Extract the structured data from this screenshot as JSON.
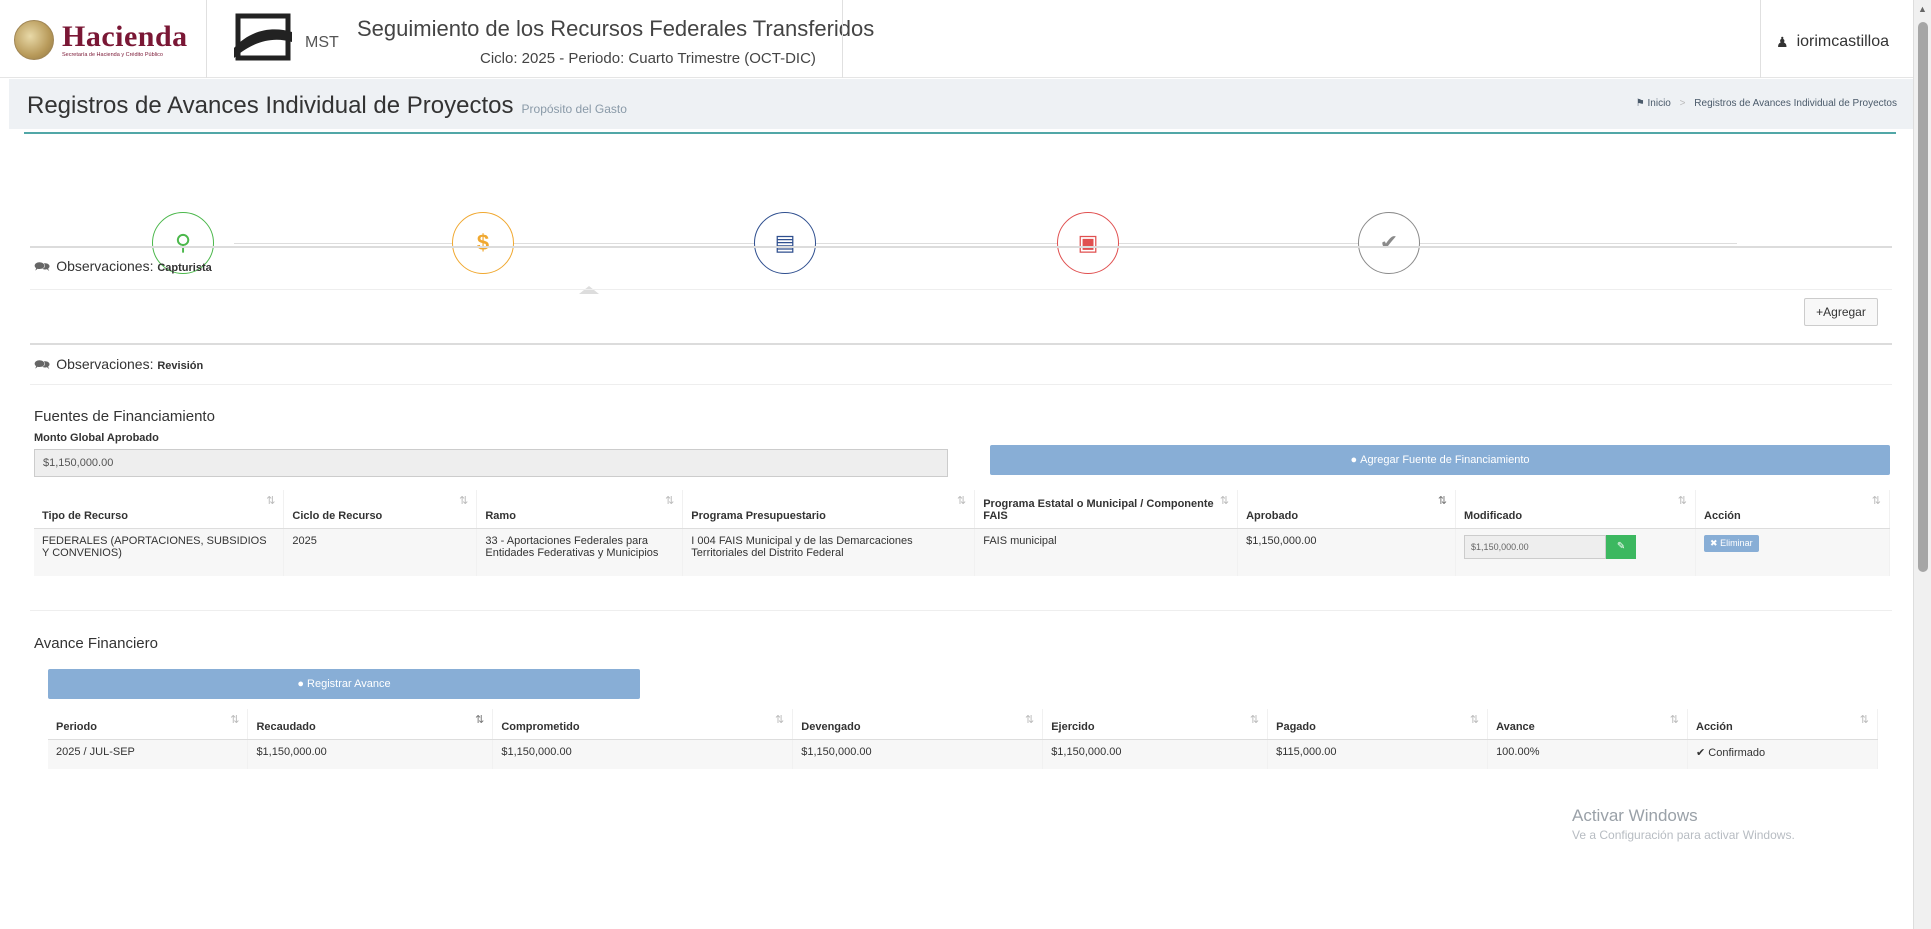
{
  "header": {
    "brand": "Hacienda",
    "brand_sub": "Secretaría de Hacienda y Crédito Público",
    "mst": "MST",
    "title": "Seguimiento de los Recursos Federales Transferidos",
    "subtitle": "Ciclo: 2025 - Periodo: Cuarto Trimestre (OCT-DIC)",
    "user": "iorimcastilloa"
  },
  "page": {
    "title": "Registros de Avances Individual de Proyectos",
    "subtitle": "Propósito del Gasto",
    "breadcrumb": [
      "Inicio",
      "Registros de Avances Individual de Proyectos"
    ]
  },
  "wizard": {
    "steps": [
      {
        "icon": "map-marker-icon",
        "glyph": "⚲",
        "color": "#4cb84c"
      },
      {
        "icon": "dollar-icon",
        "glyph": "$",
        "color": "#f0a830"
      },
      {
        "icon": "file-icon",
        "glyph": "▤",
        "color": "#2f4f8f"
      },
      {
        "icon": "image-icon",
        "glyph": "▣",
        "color": "#e05050"
      },
      {
        "icon": "check-icon",
        "glyph": "✔",
        "color": "#8a8a8a"
      }
    ]
  },
  "observaciones": {
    "capturista_label": "Observaciones:",
    "capturista_role": "Capturista",
    "revision_label": "Observaciones:",
    "revision_role": "Revisión",
    "agregar": "Agregar"
  },
  "fuentes": {
    "title": "Fuentes de Financiamiento",
    "monto_label": "Monto Global Aprobado",
    "monto_value": "$1,150,000.00",
    "add_button": "Agregar Fuente de Financiamiento",
    "headers": [
      "Tipo de Recurso",
      "Ciclo de Recurso",
      "Ramo",
      "Programa Presupuestario",
      "Programa Estatal o Municipal / Componente FAIS",
      "Aprobado",
      "Modificado",
      "Acción"
    ],
    "rows": [
      {
        "tipo": "FEDERALES (APORTACIONES, SUBSIDIOS Y CONVENIOS)",
        "ciclo": "2025",
        "ramo": "33 - Aportaciones Federales para Entidades Federativas y Municipios",
        "programa": "I 004 FAIS Municipal y de las Demarcaciones Territoriales del Distrito Federal",
        "estatal": "FAIS municipal",
        "aprobado": "$1,150,000.00",
        "modificado": "$1,150,000.00",
        "accion": "Eliminar"
      }
    ]
  },
  "avance": {
    "title": "Avance Financiero",
    "register_button": "Registrar Avance",
    "headers": [
      "Periodo",
      "Recaudado",
      "Comprometido",
      "Devengado",
      "Ejercido",
      "Pagado",
      "Avance",
      "Acción"
    ],
    "rows": [
      {
        "periodo": "2025 / JUL-SEP",
        "recaudado": "$1,150,000.00",
        "comprometido": "$1,150,000.00",
        "devengado": "$1,150,000.00",
        "ejercido": "$1,150,000.00",
        "pagado": "$115,000.00",
        "avance": "100.00%",
        "accion": "Confirmado"
      }
    ]
  },
  "watermark": {
    "line1": "Activar Windows",
    "line2": "Ve a Configuración para activar Windows."
  }
}
